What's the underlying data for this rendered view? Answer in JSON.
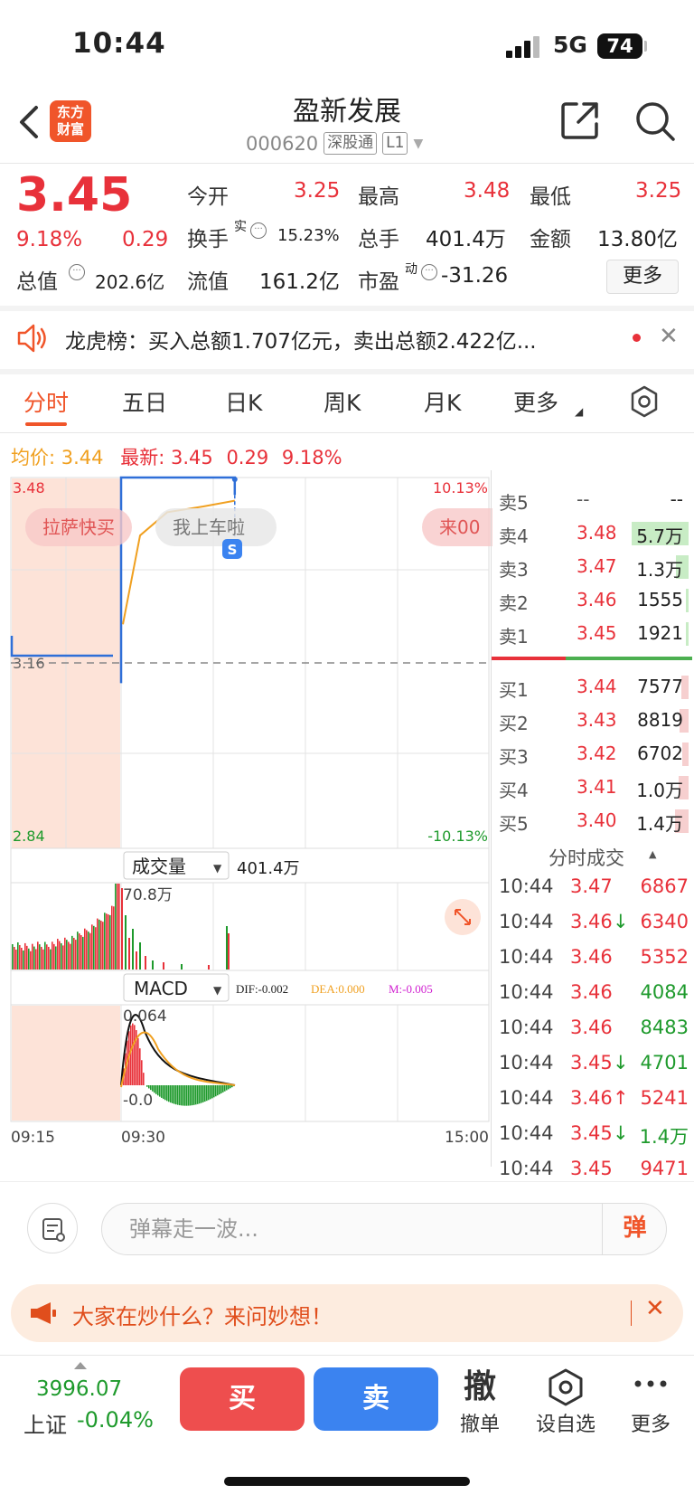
{
  "status": {
    "time": "10:44",
    "network": "5G",
    "battery": "74"
  },
  "header": {
    "title": "盈新发展",
    "code": "000620",
    "tag1": "深股通",
    "tag2": "L1",
    "logo_line1": "东方",
    "logo_line2": "财富"
  },
  "quote": {
    "price": "3.45",
    "pct": "9.18%",
    "change": "0.29",
    "open_label": "今开",
    "open": "3.25",
    "high_label": "最高",
    "high": "3.48",
    "low_label": "最低",
    "low": "3.25",
    "turnover_label": "换手",
    "turnover_sup": "实",
    "turnover": "15.23%",
    "volume_label": "总手",
    "volume": "401.4万",
    "amount_label": "金额",
    "amount": "13.80亿",
    "total_cap_label": "总值",
    "total_cap": "202.6亿",
    "float_cap_label": "流值",
    "float_cap": "161.2亿",
    "pe_label": "市盈",
    "pe_sup": "动",
    "pe": "-31.26",
    "more": "更多"
  },
  "notice": {
    "text": "龙虎榜：买入总额1.707亿元，卖出总额2.422亿..."
  },
  "tabs": [
    "分时",
    "五日",
    "日K",
    "周K",
    "月K",
    "更多"
  ],
  "avg_row": {
    "avg_label": "均价:",
    "avg": "3.44",
    "latest_label": "最新:",
    "latest": "3.45",
    "change": "0.29",
    "pct": "9.18%"
  },
  "chart": {
    "y_high": "3.48",
    "y_low": "2.84",
    "y_mid": "3.16",
    "pct_high": "10.13%",
    "pct_low": "-10.13%",
    "danmaku": [
      "拉萨快买",
      "我上车啦",
      "来00"
    ],
    "s_badge": "S",
    "vol_label": "成交量",
    "vol_value": "401.4万",
    "vol_max": "70.8万",
    "macd_label": "MACD",
    "dif": "DIF:-0.002",
    "dea": "DEA:0.000",
    "m": "M:-0.005",
    "macd_high": "0.064",
    "macd_low": "-0.0",
    "time_start": "09:15",
    "time_open": "09:30",
    "time_end": "15:00"
  },
  "chart_data": {
    "type": "line",
    "title": "",
    "ylim": [
      2.84,
      3.48
    ],
    "prev_close": 3.16,
    "series": [
      {
        "name": "",
        "x": [
          "09:15",
          "09:25",
          "09:30",
          "09:31",
          "09:32",
          "10:44"
        ],
        "values": [
          3.16,
          3.16,
          3.25,
          3.48,
          3.48,
          3.45
        ]
      },
      {
        "name": "均价",
        "x": [
          "09:30",
          "09:35",
          "09:45",
          "10:44"
        ],
        "values": [
          3.25,
          3.38,
          3.43,
          3.44
        ]
      }
    ]
  },
  "orderbook": {
    "asks": [
      {
        "label": "卖5",
        "price": "--",
        "vol": "--",
        "bar": 0.0
      },
      {
        "label": "卖4",
        "price": "3.48",
        "vol": "5.7万",
        "bar": 0.45
      },
      {
        "label": "卖3",
        "price": "3.47",
        "vol": "1.3万",
        "bar": 0.1
      },
      {
        "label": "卖2",
        "price": "3.46",
        "vol": "1555",
        "bar": 0.02
      },
      {
        "label": "卖1",
        "price": "3.45",
        "vol": "1921",
        "bar": 0.02
      }
    ],
    "bids": [
      {
        "label": "买1",
        "price": "3.44",
        "vol": "7577",
        "bar": 0.06
      },
      {
        "label": "买2",
        "price": "3.43",
        "vol": "8819",
        "bar": 0.07
      },
      {
        "label": "买3",
        "price": "3.42",
        "vol": "6702",
        "bar": 0.05
      },
      {
        "label": "买4",
        "price": "3.41",
        "vol": "1.0万",
        "bar": 0.08
      },
      {
        "label": "买5",
        "price": "3.40",
        "vol": "1.4万",
        "bar": 0.11
      }
    ]
  },
  "ticks": {
    "header": "分时成交",
    "rows": [
      {
        "time": "10:44",
        "price": "3.47",
        "arrow": "",
        "vol": "6867",
        "vcolor": "red"
      },
      {
        "time": "10:44",
        "price": "3.46",
        "arrow": "↓",
        "vol": "6340",
        "vcolor": "red"
      },
      {
        "time": "10:44",
        "price": "3.46",
        "arrow": "",
        "vol": "5352",
        "vcolor": "red"
      },
      {
        "time": "10:44",
        "price": "3.46",
        "arrow": "",
        "vol": "4084",
        "vcolor": "green"
      },
      {
        "time": "10:44",
        "price": "3.46",
        "arrow": "",
        "vol": "8483",
        "vcolor": "green"
      },
      {
        "time": "10:44",
        "price": "3.45",
        "arrow": "↓",
        "vol": "4701",
        "vcolor": "green"
      },
      {
        "time": "10:44",
        "price": "3.46",
        "arrow": "↑",
        "vol": "5241",
        "vcolor": "red"
      },
      {
        "time": "10:44",
        "price": "3.45",
        "arrow": "↓",
        "vol": "1.4万",
        "vcolor": "green"
      },
      {
        "time": "10:44",
        "price": "3.45",
        "arrow": "",
        "vol": "9471",
        "vcolor": "red"
      }
    ]
  },
  "danmu": {
    "placeholder": "弹幕走一波...",
    "btn": "弹"
  },
  "ask": {
    "text": "大家在炒什么？来问妙想！"
  },
  "bottom": {
    "index_value": "3996.07",
    "index_name": "上证",
    "index_pct": "-0.04%",
    "buy": "买",
    "sell": "卖",
    "cancel_icon": "撤",
    "cancel": "撤单",
    "watch": "设自选",
    "more": "更多"
  }
}
